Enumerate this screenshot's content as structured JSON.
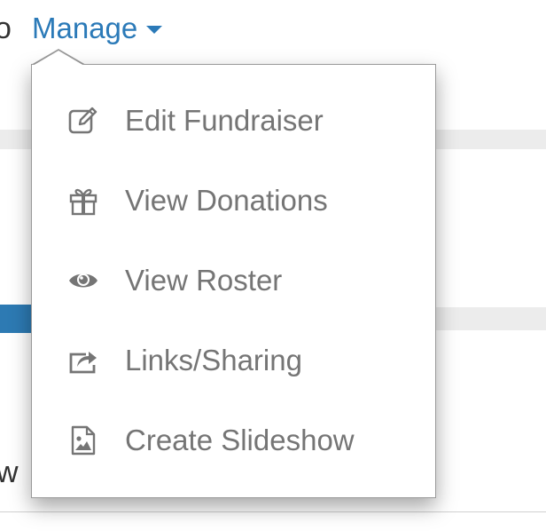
{
  "background": {
    "left_text_top": "o",
    "left_text_bottom": "w"
  },
  "manage_menu": {
    "trigger_label": "Manage",
    "items": [
      {
        "label": "Edit Fundraiser",
        "icon": "edit-icon"
      },
      {
        "label": "View Donations",
        "icon": "gift-icon"
      },
      {
        "label": "View Roster",
        "icon": "eye-icon"
      },
      {
        "label": "Links/Sharing",
        "icon": "share-icon"
      },
      {
        "label": "Create Slideshow",
        "icon": "image-file-icon"
      }
    ]
  },
  "colors": {
    "accent": "#2b7ab8",
    "menu_text": "#757575",
    "icon": "#757575",
    "menu_border": "#9a9a9a"
  }
}
